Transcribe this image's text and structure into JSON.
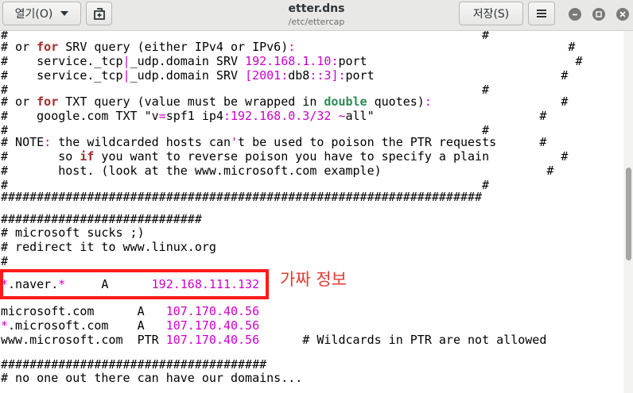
{
  "header": {
    "open_label": "열기(O)",
    "save_label": "저장(S)",
    "title": "etter.dns",
    "subtitle": "/etc/ettercap"
  },
  "icons": {
    "open_dropdown": "chevron-down-icon",
    "new_document": "new-document-icon",
    "menu": "hamburger-menu-icon",
    "minimize": "minimize-icon",
    "maximize": "maximize-icon",
    "close": "close-icon"
  },
  "editor": {
    "lines": [
      [
        "#",
        "                                                                  #"
      ],
      [
        "# or ",
        "for",
        " SRV query (either IPv4 or IPv6)",
        ":",
        "                                      #"
      ],
      [
        "#    service._tcp",
        "|",
        "_udp.domain SRV ",
        "192.168.1.10",
        ":",
        "port",
        "                             #"
      ],
      [
        "#    service._tcp",
        "|",
        "_udp.domain SRV ",
        "[",
        "2001",
        ":",
        "db8",
        "::",
        "3",
        "]",
        ":",
        "port",
        "                          #"
      ],
      [
        "#",
        "                                                                  #"
      ],
      [
        "# or ",
        "for",
        " TXT query (value must be wrapped in ",
        "double",
        " quotes)",
        ":",
        "                  #"
      ],
      [
        "#    google.com TXT \"v",
        "=",
        "spf1 ip4",
        ":",
        "192.168.0.3",
        "/",
        "32",
        " ",
        "~",
        "all\"",
        "                       #"
      ],
      [
        "#",
        "                                                                  #"
      ],
      [
        "# NOTE",
        ":",
        " the wildcarded hosts can",
        "'",
        "t be used to poison the PTR requests      #"
      ],
      [
        "#       so ",
        "if",
        " you want to reverse poison you have to specify a plain          #"
      ],
      [
        "#       host. (look at the www.microsoft.com example)                       #"
      ],
      [
        "#",
        "                                                                  #"
      ],
      [
        "###################################################################"
      ],
      [
        ""
      ],
      [
        "############################"
      ],
      [
        "# microsoft sucks ;)"
      ],
      [
        "# redirect it to www.linux.org"
      ],
      [
        "#"
      ],
      [
        "*",
        ".naver.",
        "*",
        "     A      ",
        "192.168.111.132"
      ],
      [
        "microsoft.com      A   ",
        "107.170.40.56"
      ],
      [
        "*",
        ".microsoft.com    A   ",
        "107.170.40.56"
      ],
      [
        "www.microsoft.com  PTR ",
        "107.170.40.56",
        "      # Wildcards in PTR are not allowed"
      ],
      [
        ""
      ],
      [
        "#####################################"
      ],
      [
        "# no one out there can have our domains..."
      ]
    ]
  },
  "annotation": {
    "label": "가짜 정보"
  },
  "colors": {
    "keyword": "#a52a2a",
    "literal": "#cc00cc",
    "special": "#2e8b57",
    "highlight_box": "#ff1a1a",
    "annotation_text": "#e53935"
  }
}
